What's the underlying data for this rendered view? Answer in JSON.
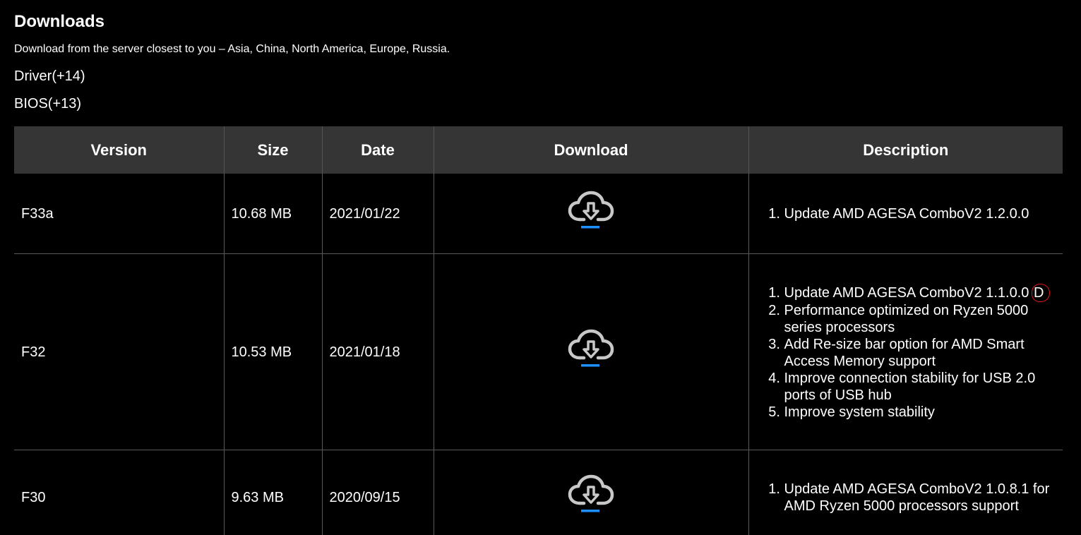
{
  "page": {
    "title": "Downloads",
    "subtitle": "Download from the server closest to you – Asia, China, North America, Europe, Russia."
  },
  "categories": {
    "driver": "Driver(+14)",
    "bios": "BIOS(+13)"
  },
  "table": {
    "headers": {
      "version": "Version",
      "size": "Size",
      "date": "Date",
      "download": "Download",
      "description": "Description"
    },
    "rows": [
      {
        "version": "F33a",
        "size": "10.68 MB",
        "date": "2021/01/22",
        "download_icon": "cloud-download-icon",
        "description": [
          "Update AMD AGESA ComboV2 1.2.0.0"
        ]
      },
      {
        "version": "F32",
        "size": "10.53 MB",
        "date": "2021/01/18",
        "download_icon": "cloud-download-icon",
        "description": [
          "Update AMD AGESA ComboV2 1.1.0.0",
          "Performance optimized on Ryzen 5000 series processors",
          "Add Re-size bar option for AMD Smart Access Memory support",
          "Improve connection stability for USB 2.0 ports of USB hub",
          "Improve system stability"
        ],
        "description_annotated_suffix": "D"
      },
      {
        "version": "F30",
        "size": "9.63 MB",
        "date": "2020/09/15",
        "download_icon": "cloud-download-icon",
        "description": [
          "Update AMD AGESA ComboV2 1.0.8.1 for AMD Ryzen 5000 processors support"
        ]
      }
    ]
  },
  "colors": {
    "background": "#000000",
    "header_bg": "#353535",
    "grid_line": "#5a5a5a",
    "icon_gray": "#c8c8c8",
    "icon_accent": "#1e90ff",
    "annotation_red": "#e0141e"
  }
}
